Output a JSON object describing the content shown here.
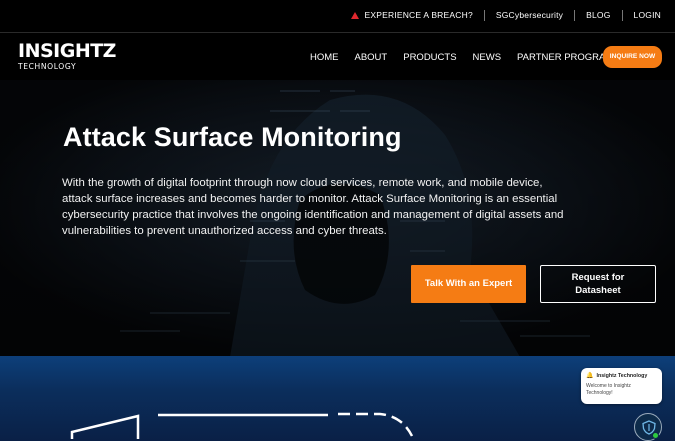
{
  "topbar": {
    "breach": "EXPERIENCE A BREACH?",
    "sg": "SGCybersecurity",
    "blog": "BLOG",
    "login": "LOGIN"
  },
  "logo": {
    "line1": "INSIGHTZ",
    "line2": "TECHNOLOGY"
  },
  "nav": {
    "home": "HOME",
    "about": "ABOUT",
    "products": "PRODUCTS",
    "news": "NEWS",
    "partner": "PARTNER PROGRAM",
    "inquire": "INQUIRE NOW"
  },
  "hero": {
    "title": "Attack Surface Monitoring",
    "description": "With the growth of digital footprint through now cloud services, remote work, and mobile device, attack surface increases and becomes harder to monitor. Attack Surface Monitoring is an essential cybersecurity practice that involves the ongoing identification and management of digital assets and vulnerabilities to prevent unauthorized access and cyber threats.",
    "cta_primary": "Talk With an Expert",
    "cta_secondary_line1": "Request for",
    "cta_secondary_line2": "Datasheet"
  },
  "chat": {
    "title": "Insightz Technology",
    "message": "Welcome to Insightz Technology!"
  },
  "colors": {
    "accent": "#f57c14",
    "warning": "#e0282e",
    "section_blue": "#0d3f7a"
  },
  "icons": [
    "warning-icon",
    "bell-icon",
    "shield-icon"
  ]
}
